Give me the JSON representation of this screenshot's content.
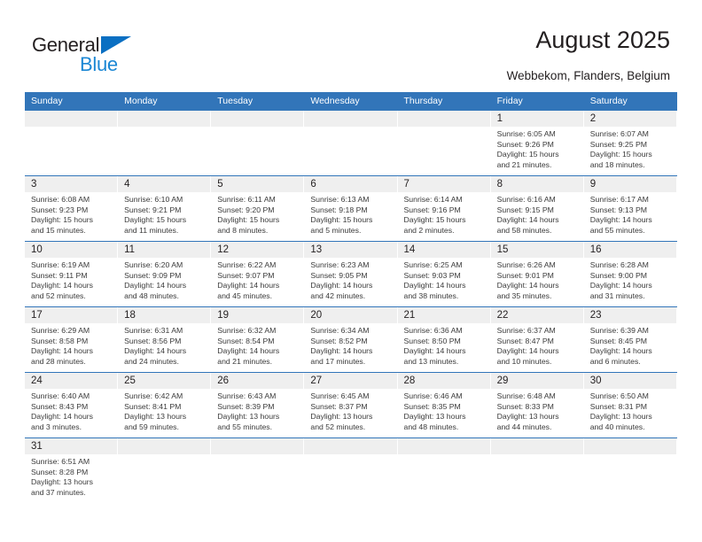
{
  "brand": {
    "name_top": "General",
    "name_bottom": "Blue",
    "triangle_color": "#0a6fc2",
    "blue_text_color": "#1b87d4"
  },
  "header": {
    "title": "August 2025",
    "subtitle": "Webbekom, Flanders, Belgium"
  },
  "theme": {
    "header_blue": "#3275b9",
    "date_band": "#efefef",
    "text": "#231f20"
  },
  "weekdays": [
    "Sunday",
    "Monday",
    "Tuesday",
    "Wednesday",
    "Thursday",
    "Friday",
    "Saturday"
  ],
  "weeks": [
    [
      {
        "date": "",
        "sunrise": "",
        "sunset": "",
        "daylight1": "",
        "daylight2": ""
      },
      {
        "date": "",
        "sunrise": "",
        "sunset": "",
        "daylight1": "",
        "daylight2": ""
      },
      {
        "date": "",
        "sunrise": "",
        "sunset": "",
        "daylight1": "",
        "daylight2": ""
      },
      {
        "date": "",
        "sunrise": "",
        "sunset": "",
        "daylight1": "",
        "daylight2": ""
      },
      {
        "date": "",
        "sunrise": "",
        "sunset": "",
        "daylight1": "",
        "daylight2": ""
      },
      {
        "date": "1",
        "sunrise": "Sunrise: 6:05 AM",
        "sunset": "Sunset: 9:26 PM",
        "daylight1": "Daylight: 15 hours",
        "daylight2": "and 21 minutes."
      },
      {
        "date": "2",
        "sunrise": "Sunrise: 6:07 AM",
        "sunset": "Sunset: 9:25 PM",
        "daylight1": "Daylight: 15 hours",
        "daylight2": "and 18 minutes."
      }
    ],
    [
      {
        "date": "3",
        "sunrise": "Sunrise: 6:08 AM",
        "sunset": "Sunset: 9:23 PM",
        "daylight1": "Daylight: 15 hours",
        "daylight2": "and 15 minutes."
      },
      {
        "date": "4",
        "sunrise": "Sunrise: 6:10 AM",
        "sunset": "Sunset: 9:21 PM",
        "daylight1": "Daylight: 15 hours",
        "daylight2": "and 11 minutes."
      },
      {
        "date": "5",
        "sunrise": "Sunrise: 6:11 AM",
        "sunset": "Sunset: 9:20 PM",
        "daylight1": "Daylight: 15 hours",
        "daylight2": "and 8 minutes."
      },
      {
        "date": "6",
        "sunrise": "Sunrise: 6:13 AM",
        "sunset": "Sunset: 9:18 PM",
        "daylight1": "Daylight: 15 hours",
        "daylight2": "and 5 minutes."
      },
      {
        "date": "7",
        "sunrise": "Sunrise: 6:14 AM",
        "sunset": "Sunset: 9:16 PM",
        "daylight1": "Daylight: 15 hours",
        "daylight2": "and 2 minutes."
      },
      {
        "date": "8",
        "sunrise": "Sunrise: 6:16 AM",
        "sunset": "Sunset: 9:15 PM",
        "daylight1": "Daylight: 14 hours",
        "daylight2": "and 58 minutes."
      },
      {
        "date": "9",
        "sunrise": "Sunrise: 6:17 AM",
        "sunset": "Sunset: 9:13 PM",
        "daylight1": "Daylight: 14 hours",
        "daylight2": "and 55 minutes."
      }
    ],
    [
      {
        "date": "10",
        "sunrise": "Sunrise: 6:19 AM",
        "sunset": "Sunset: 9:11 PM",
        "daylight1": "Daylight: 14 hours",
        "daylight2": "and 52 minutes."
      },
      {
        "date": "11",
        "sunrise": "Sunrise: 6:20 AM",
        "sunset": "Sunset: 9:09 PM",
        "daylight1": "Daylight: 14 hours",
        "daylight2": "and 48 minutes."
      },
      {
        "date": "12",
        "sunrise": "Sunrise: 6:22 AM",
        "sunset": "Sunset: 9:07 PM",
        "daylight1": "Daylight: 14 hours",
        "daylight2": "and 45 minutes."
      },
      {
        "date": "13",
        "sunrise": "Sunrise: 6:23 AM",
        "sunset": "Sunset: 9:05 PM",
        "daylight1": "Daylight: 14 hours",
        "daylight2": "and 42 minutes."
      },
      {
        "date": "14",
        "sunrise": "Sunrise: 6:25 AM",
        "sunset": "Sunset: 9:03 PM",
        "daylight1": "Daylight: 14 hours",
        "daylight2": "and 38 minutes."
      },
      {
        "date": "15",
        "sunrise": "Sunrise: 6:26 AM",
        "sunset": "Sunset: 9:01 PM",
        "daylight1": "Daylight: 14 hours",
        "daylight2": "and 35 minutes."
      },
      {
        "date": "16",
        "sunrise": "Sunrise: 6:28 AM",
        "sunset": "Sunset: 9:00 PM",
        "daylight1": "Daylight: 14 hours",
        "daylight2": "and 31 minutes."
      }
    ],
    [
      {
        "date": "17",
        "sunrise": "Sunrise: 6:29 AM",
        "sunset": "Sunset: 8:58 PM",
        "daylight1": "Daylight: 14 hours",
        "daylight2": "and 28 minutes."
      },
      {
        "date": "18",
        "sunrise": "Sunrise: 6:31 AM",
        "sunset": "Sunset: 8:56 PM",
        "daylight1": "Daylight: 14 hours",
        "daylight2": "and 24 minutes."
      },
      {
        "date": "19",
        "sunrise": "Sunrise: 6:32 AM",
        "sunset": "Sunset: 8:54 PM",
        "daylight1": "Daylight: 14 hours",
        "daylight2": "and 21 minutes."
      },
      {
        "date": "20",
        "sunrise": "Sunrise: 6:34 AM",
        "sunset": "Sunset: 8:52 PM",
        "daylight1": "Daylight: 14 hours",
        "daylight2": "and 17 minutes."
      },
      {
        "date": "21",
        "sunrise": "Sunrise: 6:36 AM",
        "sunset": "Sunset: 8:50 PM",
        "daylight1": "Daylight: 14 hours",
        "daylight2": "and 13 minutes."
      },
      {
        "date": "22",
        "sunrise": "Sunrise: 6:37 AM",
        "sunset": "Sunset: 8:47 PM",
        "daylight1": "Daylight: 14 hours",
        "daylight2": "and 10 minutes."
      },
      {
        "date": "23",
        "sunrise": "Sunrise: 6:39 AM",
        "sunset": "Sunset: 8:45 PM",
        "daylight1": "Daylight: 14 hours",
        "daylight2": "and 6 minutes."
      }
    ],
    [
      {
        "date": "24",
        "sunrise": "Sunrise: 6:40 AM",
        "sunset": "Sunset: 8:43 PM",
        "daylight1": "Daylight: 14 hours",
        "daylight2": "and 3 minutes."
      },
      {
        "date": "25",
        "sunrise": "Sunrise: 6:42 AM",
        "sunset": "Sunset: 8:41 PM",
        "daylight1": "Daylight: 13 hours",
        "daylight2": "and 59 minutes."
      },
      {
        "date": "26",
        "sunrise": "Sunrise: 6:43 AM",
        "sunset": "Sunset: 8:39 PM",
        "daylight1": "Daylight: 13 hours",
        "daylight2": "and 55 minutes."
      },
      {
        "date": "27",
        "sunrise": "Sunrise: 6:45 AM",
        "sunset": "Sunset: 8:37 PM",
        "daylight1": "Daylight: 13 hours",
        "daylight2": "and 52 minutes."
      },
      {
        "date": "28",
        "sunrise": "Sunrise: 6:46 AM",
        "sunset": "Sunset: 8:35 PM",
        "daylight1": "Daylight: 13 hours",
        "daylight2": "and 48 minutes."
      },
      {
        "date": "29",
        "sunrise": "Sunrise: 6:48 AM",
        "sunset": "Sunset: 8:33 PM",
        "daylight1": "Daylight: 13 hours",
        "daylight2": "and 44 minutes."
      },
      {
        "date": "30",
        "sunrise": "Sunrise: 6:50 AM",
        "sunset": "Sunset: 8:31 PM",
        "daylight1": "Daylight: 13 hours",
        "daylight2": "and 40 minutes."
      }
    ],
    [
      {
        "date": "31",
        "sunrise": "Sunrise: 6:51 AM",
        "sunset": "Sunset: 8:28 PM",
        "daylight1": "Daylight: 13 hours",
        "daylight2": "and 37 minutes."
      },
      {
        "date": "",
        "sunrise": "",
        "sunset": "",
        "daylight1": "",
        "daylight2": ""
      },
      {
        "date": "",
        "sunrise": "",
        "sunset": "",
        "daylight1": "",
        "daylight2": ""
      },
      {
        "date": "",
        "sunrise": "",
        "sunset": "",
        "daylight1": "",
        "daylight2": ""
      },
      {
        "date": "",
        "sunrise": "",
        "sunset": "",
        "daylight1": "",
        "daylight2": ""
      },
      {
        "date": "",
        "sunrise": "",
        "sunset": "",
        "daylight1": "",
        "daylight2": ""
      },
      {
        "date": "",
        "sunrise": "",
        "sunset": "",
        "daylight1": "",
        "daylight2": ""
      }
    ]
  ]
}
